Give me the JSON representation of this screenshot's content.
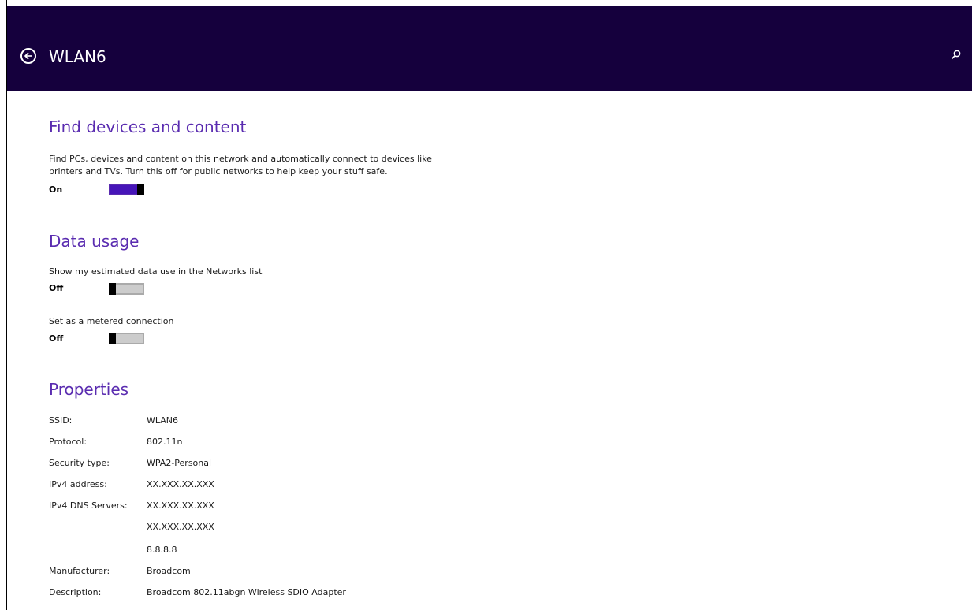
{
  "header": {
    "title": "WLAN6",
    "colors": {
      "background": "#15003d",
      "text": "#ffffff"
    },
    "back_icon": "back-arrow-circle-icon",
    "search_icon": "search-icon"
  },
  "sections": {
    "find_devices": {
      "heading": "Find devices and content",
      "description": "Find PCs, devices and content on this network and automatically connect to devices like printers and TVs. Turn this off for public networks to help keep your stuff safe.",
      "state_label": "On",
      "toggle_on": true
    },
    "data_usage": {
      "heading": "Data usage",
      "show_usage": {
        "description": "Show my estimated data use in the Networks list",
        "state_label": "Off",
        "toggle_on": false
      },
      "metered": {
        "description": "Set as a metered connection",
        "state_label": "Off",
        "toggle_on": false
      }
    },
    "properties": {
      "heading": "Properties",
      "rows": [
        {
          "label": "SSID:",
          "value": "WLAN6"
        },
        {
          "label": "Protocol:",
          "value": "802.11n"
        },
        {
          "label": "Security type:",
          "value": "WPA2-Personal"
        },
        {
          "label": "IPv4 address:",
          "value": "XX.XXX.XX.XXX"
        },
        {
          "label": "IPv4 DNS Servers:",
          "value": "XX.XXX.XX.XXX"
        },
        {
          "label": "",
          "value": "XX.XXX.XX.XXX"
        },
        {
          "label": "",
          "value": "8.8.8.8"
        },
        {
          "label": "Manufacturer:",
          "value": "Broadcom"
        },
        {
          "label": "Description:",
          "value": "Broadcom 802.11abgn Wireless SDIO Adapter"
        }
      ]
    }
  },
  "colors": {
    "accent": "#5a2cb0",
    "toggle_on": "#4615b8",
    "toggle_off": "#cccccc"
  }
}
